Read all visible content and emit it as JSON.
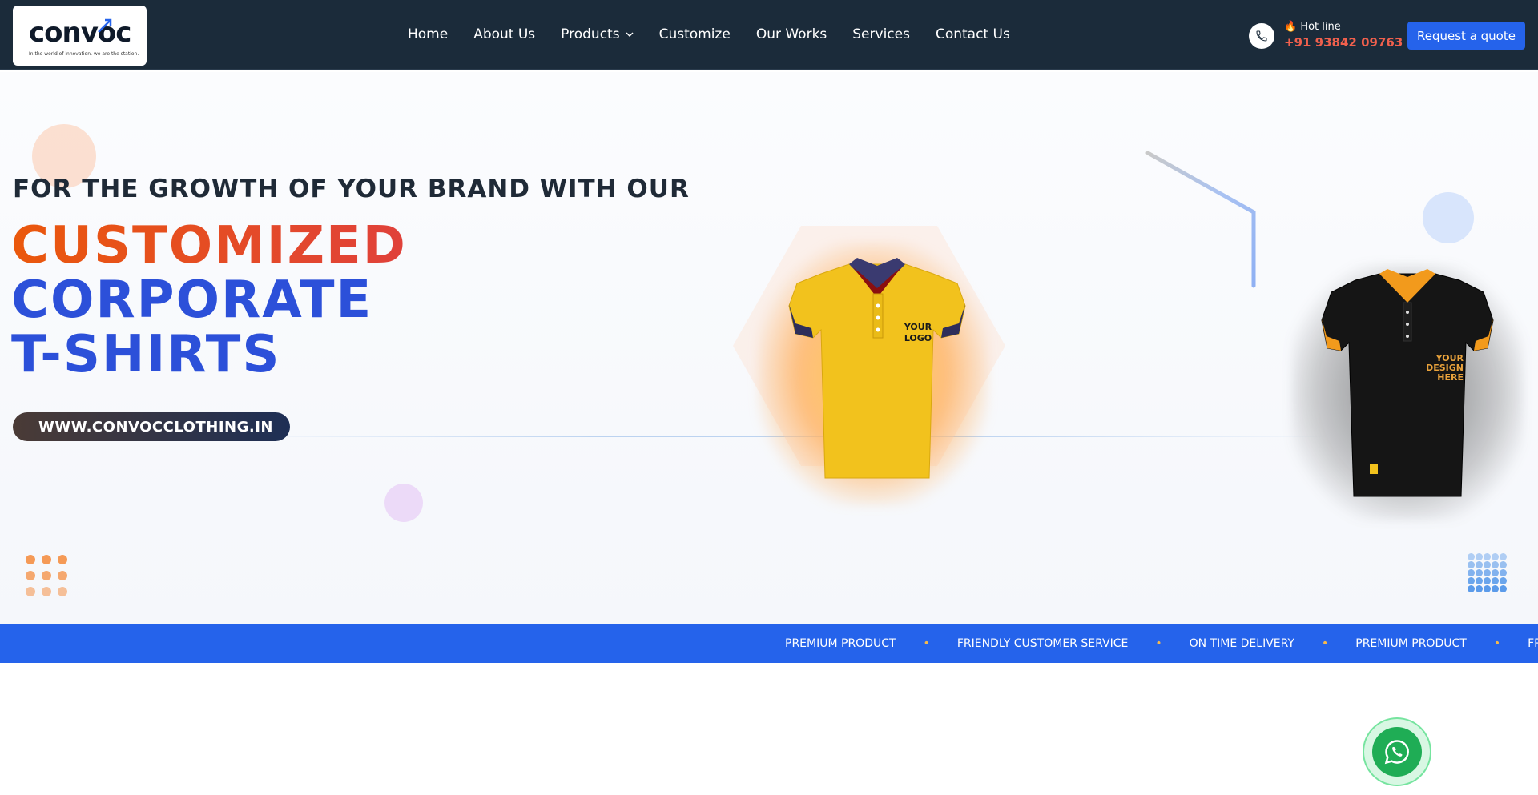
{
  "brand": {
    "name": "convoc",
    "tagline": "In the world of innovation, we are the station."
  },
  "nav": {
    "items": [
      {
        "label": "Home"
      },
      {
        "label": "About Us"
      },
      {
        "label": "Products"
      },
      {
        "label": "Customize"
      },
      {
        "label": "Our Works"
      },
      {
        "label": "Services"
      },
      {
        "label": "Contact Us"
      }
    ]
  },
  "hotline": {
    "label": "🔥 Hot line",
    "number": "+91 93842 09763"
  },
  "cta": {
    "quote_label": "Request a quote"
  },
  "hero": {
    "tagline": "FOR THE GROWTH OF YOUR BRAND WITH OUR",
    "line1": "CUSTOMIZED",
    "line2": "CORPORATE",
    "line3": "T-SHIRTS",
    "website": "WWW.CONVOCCLOTHING.IN",
    "yellow_shirt_text": "YOUR LOGO",
    "black_shirt_text": "YOUR DESIGN HERE"
  },
  "ticker": {
    "items": [
      "PREMIUM PRODUCT",
      "FRIENDLY CUSTOMER SERVICE",
      "ON TIME DELIVERY",
      "PREMIUM PRODUCT",
      "FRIENDLY CUSTOMER SERVICE"
    ]
  },
  "colors": {
    "nav_bg": "#1b2b3a",
    "accent_blue": "#2563eb",
    "accent_orange": "#ea580c",
    "hotline_red": "#f0604d",
    "whatsapp_green": "#1fad55"
  }
}
